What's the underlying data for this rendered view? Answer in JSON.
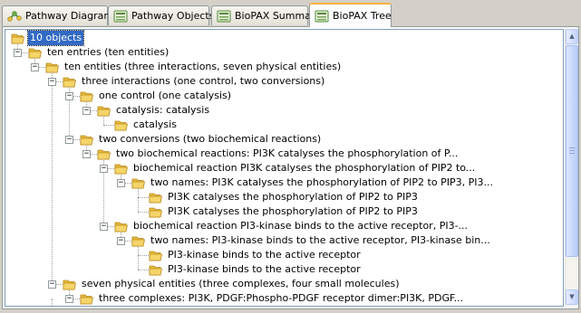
{
  "tabs": [
    {
      "label": "Pathway Diagram",
      "icon": "pathway-diagram-icon"
    },
    {
      "label": "Pathway Objects",
      "icon": "pathway-objects-icon"
    },
    {
      "label": "BioPAX Summary",
      "icon": "biopax-summary-icon"
    },
    {
      "label": "BioPAX Tree",
      "icon": "biopax-tree-icon"
    }
  ],
  "active_tab": "BioPAX Tree",
  "colors": {
    "selection": "#316ac5",
    "folder": "#f5d56a",
    "active_tab_accent": "#f8b33c"
  },
  "tree": [
    {
      "label": "10 objects",
      "depth": 0,
      "expanded": true,
      "selected": true
    },
    {
      "label": "ten entries (ten entities)",
      "depth": 1,
      "expanded": true
    },
    {
      "label": "ten entities (three interactions, seven physical entities)",
      "depth": 2,
      "expanded": true
    },
    {
      "label": "three interactions (one control, two conversions)",
      "depth": 3,
      "expanded": true
    },
    {
      "label": "one control (one catalysis)",
      "depth": 4,
      "expanded": true
    },
    {
      "label": "catalysis: catalysis",
      "depth": 5,
      "expanded": true
    },
    {
      "label": "catalysis",
      "depth": 6,
      "expanded": false
    },
    {
      "label": "two conversions (two biochemical reactions)",
      "depth": 4,
      "expanded": true
    },
    {
      "label": "two biochemical reactions: PI3K catalyses the phosphorylation of P...",
      "depth": 5,
      "expanded": true
    },
    {
      "label": "biochemical reaction PI3K catalyses the phosphorylation of PIP2 to...",
      "depth": 6,
      "expanded": true
    },
    {
      "label": "two names: PI3K catalyses the phosphorylation of PIP2 to PIP3, PI3...",
      "depth": 7,
      "expanded": true
    },
    {
      "label": "PI3K catalyses the phosphorylation of PIP2 to PIP3",
      "depth": 8,
      "expanded": false
    },
    {
      "label": "PI3K catalyses the phosphorylation of PIP2 to PIP3",
      "depth": 8,
      "expanded": false
    },
    {
      "label": "biochemical reaction PI3-kinase binds to the active receptor, PI3-...",
      "depth": 6,
      "expanded": true
    },
    {
      "label": "two names: PI3-kinase binds to the active receptor, PI3-kinase bin...",
      "depth": 7,
      "expanded": true
    },
    {
      "label": "PI3-kinase binds to the active receptor",
      "depth": 8,
      "expanded": false
    },
    {
      "label": "PI3-kinase binds to the active receptor",
      "depth": 8,
      "expanded": false
    },
    {
      "label": "seven physical entities (three complexes, four small molecules)",
      "depth": 3,
      "expanded": true
    },
    {
      "label": "three complexes: PI3K, PDGF:Phospho-PDGF receptor dimer:PI3K, PDGF...",
      "depth": 4,
      "expanded": true
    }
  ]
}
